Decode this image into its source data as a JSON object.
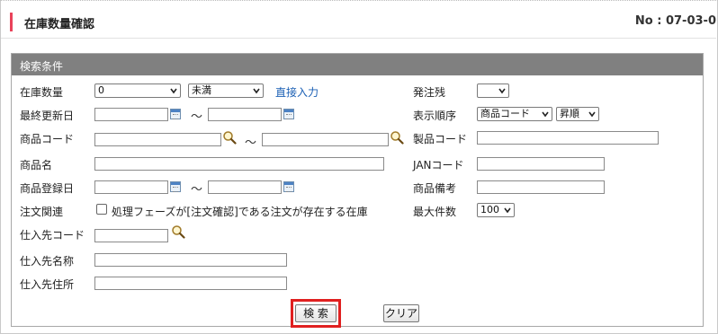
{
  "header": {
    "title": "在庫数量確認",
    "code": "No : 07-03-0"
  },
  "panel": {
    "title": "検索条件"
  },
  "left": {
    "stock_qty_label": "在庫数量",
    "stock_qty_value": "0",
    "stock_cond_value": "未満",
    "direct_input_link": "直接入力",
    "last_updated_label": "最終更新日",
    "product_code_label": "商品コード",
    "product_name_label": "商品名",
    "product_reg_date_label": "商品登録日",
    "order_related_label": "注文関連",
    "order_related_check_label": "処理フェーズが[注文確認]である注文が存在する在庫",
    "supplier_code_label": "仕入先コード",
    "supplier_name_label": "仕入先名称",
    "supplier_address_label": "仕入先住所",
    "tilde": "～"
  },
  "right": {
    "order_remaining_label": "発注残",
    "order_remaining_value": "",
    "display_order_label": "表示順序",
    "display_order_value": "商品コード",
    "sort_dir_value": "昇順",
    "manufacturer_code_label": "製品コード",
    "jan_code_label": "JANコード",
    "product_note_label": "商品備考",
    "max_count_label": "最大件数",
    "max_count_value": "100"
  },
  "buttons": {
    "search_label": "検 索",
    "clear_label": "クリア"
  }
}
